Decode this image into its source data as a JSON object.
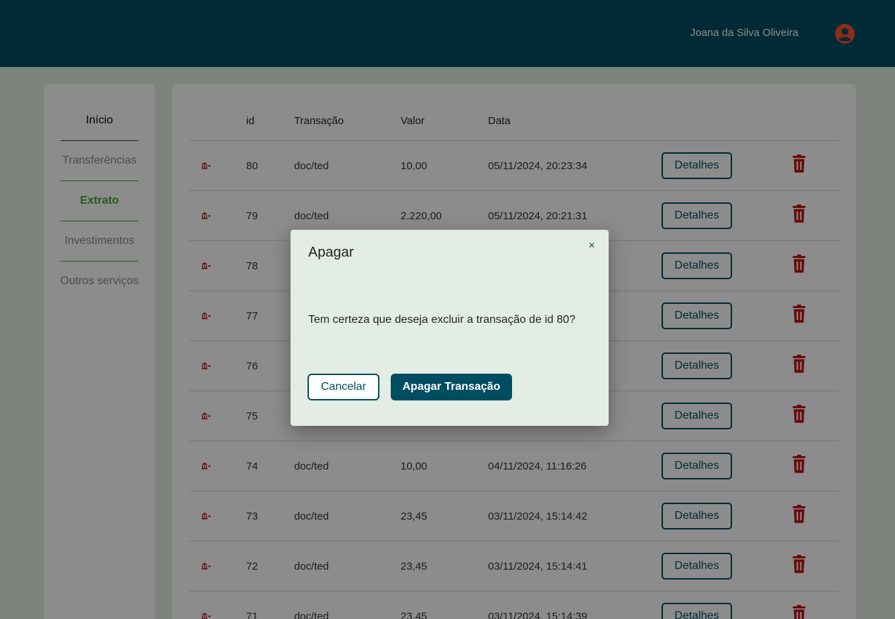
{
  "header": {
    "user_name": "Joana da Silva Oliveira",
    "avatar_icon": "user-circle-icon",
    "accent": "#ff5031"
  },
  "sidebar": {
    "items": [
      {
        "label": "Início",
        "state": "normal"
      },
      {
        "label": "Transferências",
        "state": "muted"
      },
      {
        "label": "Extrato",
        "state": "active"
      },
      {
        "label": "Investimentos",
        "state": "muted"
      },
      {
        "label": "Outros serviços",
        "state": "muted"
      }
    ]
  },
  "table": {
    "headers": [
      "id",
      "Transação",
      "Valor",
      "Data"
    ],
    "details_label": "Detalhes",
    "rows": [
      {
        "id": "80",
        "type": "doc/ted",
        "value": "10,00",
        "date": "05/11/2024, 20:23:34"
      },
      {
        "id": "79",
        "type": "doc/ted",
        "value": "2.220,00",
        "date": "05/11/2024, 20:21:31"
      },
      {
        "id": "78",
        "type": "",
        "value": "",
        "date": ""
      },
      {
        "id": "77",
        "type": "",
        "value": "",
        "date": ""
      },
      {
        "id": "76",
        "type": "",
        "value": "",
        "date": ""
      },
      {
        "id": "75",
        "type": "",
        "value": "",
        "date": ""
      },
      {
        "id": "74",
        "type": "doc/ted",
        "value": "10,00",
        "date": "04/11/2024, 11:16:26"
      },
      {
        "id": "73",
        "type": "doc/ted",
        "value": "23,45",
        "date": "03/11/2024, 15:14:42"
      },
      {
        "id": "72",
        "type": "doc/ted",
        "value": "23,45",
        "date": "03/11/2024, 15:14:41"
      },
      {
        "id": "71",
        "type": "doc/ted",
        "value": "23,45",
        "date": "03/11/2024, 15:14:39"
      }
    ]
  },
  "modal": {
    "title": "Apagar",
    "close_symbol": "×",
    "message": "Tem certeza que deseja excluir a transação de id 80?",
    "cancel_label": "Cancelar",
    "confirm_label": "Apagar Transação"
  },
  "colors": {
    "primary": "#004d61",
    "green": "#47a138",
    "danger": "#bf1313",
    "background": "#e4ede4"
  }
}
